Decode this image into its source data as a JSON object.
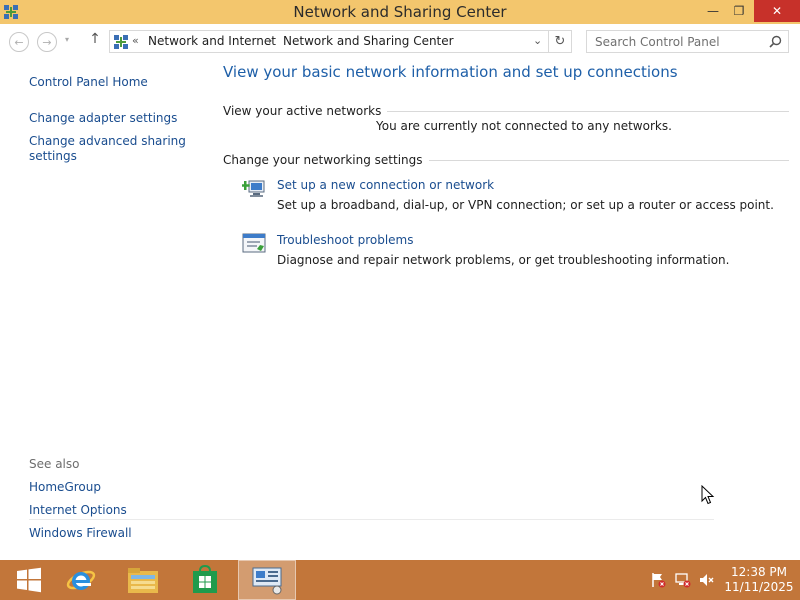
{
  "window": {
    "title": "Network and Sharing Center",
    "controls": {
      "minimize": "—",
      "maximize": "❐",
      "close": "✕"
    }
  },
  "address_bar": {
    "overflow": "«",
    "breadcrumbs": [
      "Network and Internet",
      "Network and Sharing Center"
    ],
    "separator": "›",
    "dropdown": "⌄",
    "refresh": "↻",
    "search_placeholder": "Search Control Panel"
  },
  "nav": {
    "back": "←",
    "forward": "→",
    "recent": "▾",
    "up": "↑"
  },
  "sidebar": {
    "home": "Control Panel Home",
    "links": [
      "Change adapter settings",
      "Change advanced sharing settings"
    ],
    "see_also_heading": "See also",
    "see_also": [
      "HomeGroup",
      "Internet Options",
      "Windows Firewall"
    ]
  },
  "main": {
    "title": "View your basic network information and set up connections",
    "active_networks_heading": "View your active networks",
    "active_networks_status": "You are currently not connected to any networks.",
    "settings_heading": "Change your networking settings",
    "tasks": [
      {
        "link": "Set up a new connection or network",
        "description": "Set up a broadband, dial-up, or VPN connection; or set up a router or access point.",
        "icon": "new-connection-icon"
      },
      {
        "link": "Troubleshoot problems",
        "description": "Diagnose and repair network problems, or get troubleshooting information.",
        "icon": "troubleshoot-icon"
      }
    ]
  },
  "taskbar": {
    "apps": [
      "start-icon",
      "internet-explorer-icon",
      "file-explorer-icon",
      "store-icon",
      "control-panel-icon"
    ],
    "clock_time": "12:38 PM",
    "clock_date": "11/11/2025"
  },
  "colors": {
    "titlebar": "#f3c66d",
    "taskbar": "#c2763a",
    "link": "#1a4d8f",
    "heading": "#1e5fa8",
    "close_button": "#c7312a"
  }
}
